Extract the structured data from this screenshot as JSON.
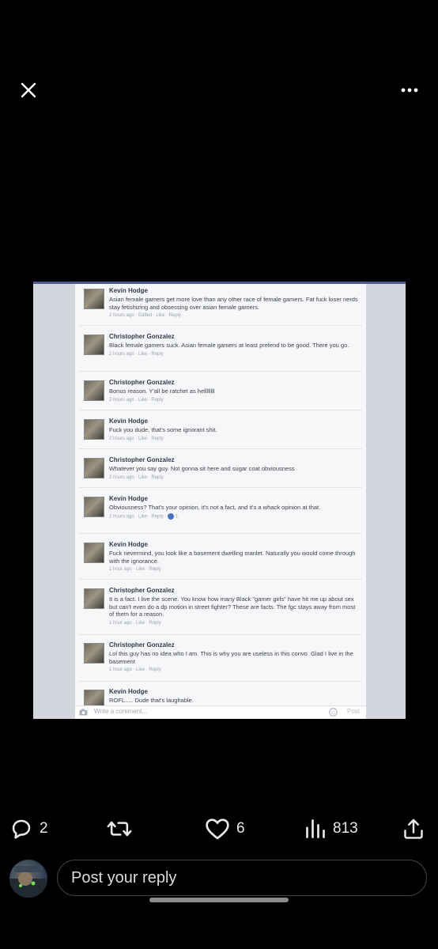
{
  "media": {
    "comments": [
      {
        "name": "Kevin Hodge",
        "text": "Asian female gamers get more love than any other race of female gamers. Fat fuck loser nerds stay fetishizing and obsessing over asian female gamers.",
        "meta": "2 hours ago · Edited · Like · Reply"
      },
      {
        "name": "Christopher Gonzalez",
        "text": "Black female gamers suck. Asian female gamers at least pretend to be good. There you go.",
        "meta": "2 hours ago · Like · Reply"
      },
      {
        "name": "Christopher Gonzalez",
        "text": "Bonus reason. Y'all be ratchet as hellllllll",
        "meta": "2 hours ago · Like · Reply"
      },
      {
        "name": "Kevin Hodge",
        "text": "Fuck you dude, that's some ignorant shit.",
        "meta": "2 hours ago · Like · Reply"
      },
      {
        "name": "Christopher Gonzalez",
        "text": "Whatever you say guy. Not gonna sit here and sugar coat obviousness",
        "meta": "2 hours ago · Like · Reply"
      },
      {
        "name": "Kevin Hodge",
        "text": "Obviousness? That's your opinion, it's not a fact, and it's a whack opinion at that.",
        "meta": "2 hours ago · Like · Reply ·",
        "likes": "1"
      },
      {
        "name": "Kevin Hodge",
        "text": "Fuck nevermind, you look like a basement dwelling manlet. Naturally you would come through with the ignorance.",
        "meta": "1 hour ago · Like · Reply"
      },
      {
        "name": "Christopher Gonzalez",
        "text": "It is a fact. I live the scene. You know how many Black \"gamer girls\" have hit me up about sex but can't even do a dp motion in street fighter? These are facts. The fgc stays away from most of them for a reason.",
        "meta": "1 hour ago · Like · Reply"
      },
      {
        "name": "Christopher Gonzalez",
        "text": "Lol this guy has no idea who I am. This is why you are useless in this convo. Glad I live in the basement",
        "meta": "1 hour ago · Like · Reply"
      },
      {
        "name": "Kevin Hodge",
        "text": "ROFL..... Dude that's laughable.",
        "meta": ""
      }
    ],
    "write_placeholder": "Write a comment...",
    "post_label": "Post"
  },
  "actions": {
    "replies": "2",
    "likes": "6",
    "views": "813"
  },
  "reply": {
    "placeholder": "Post your reply"
  },
  "colors": {
    "background": "#000000",
    "text": "#e7e9ea",
    "border": "#3e4144"
  },
  "icons": [
    "close-icon",
    "more-icon",
    "reply-icon",
    "repost-icon",
    "like-icon",
    "views-icon",
    "share-icon",
    "camera-icon",
    "smiley-icon"
  ]
}
